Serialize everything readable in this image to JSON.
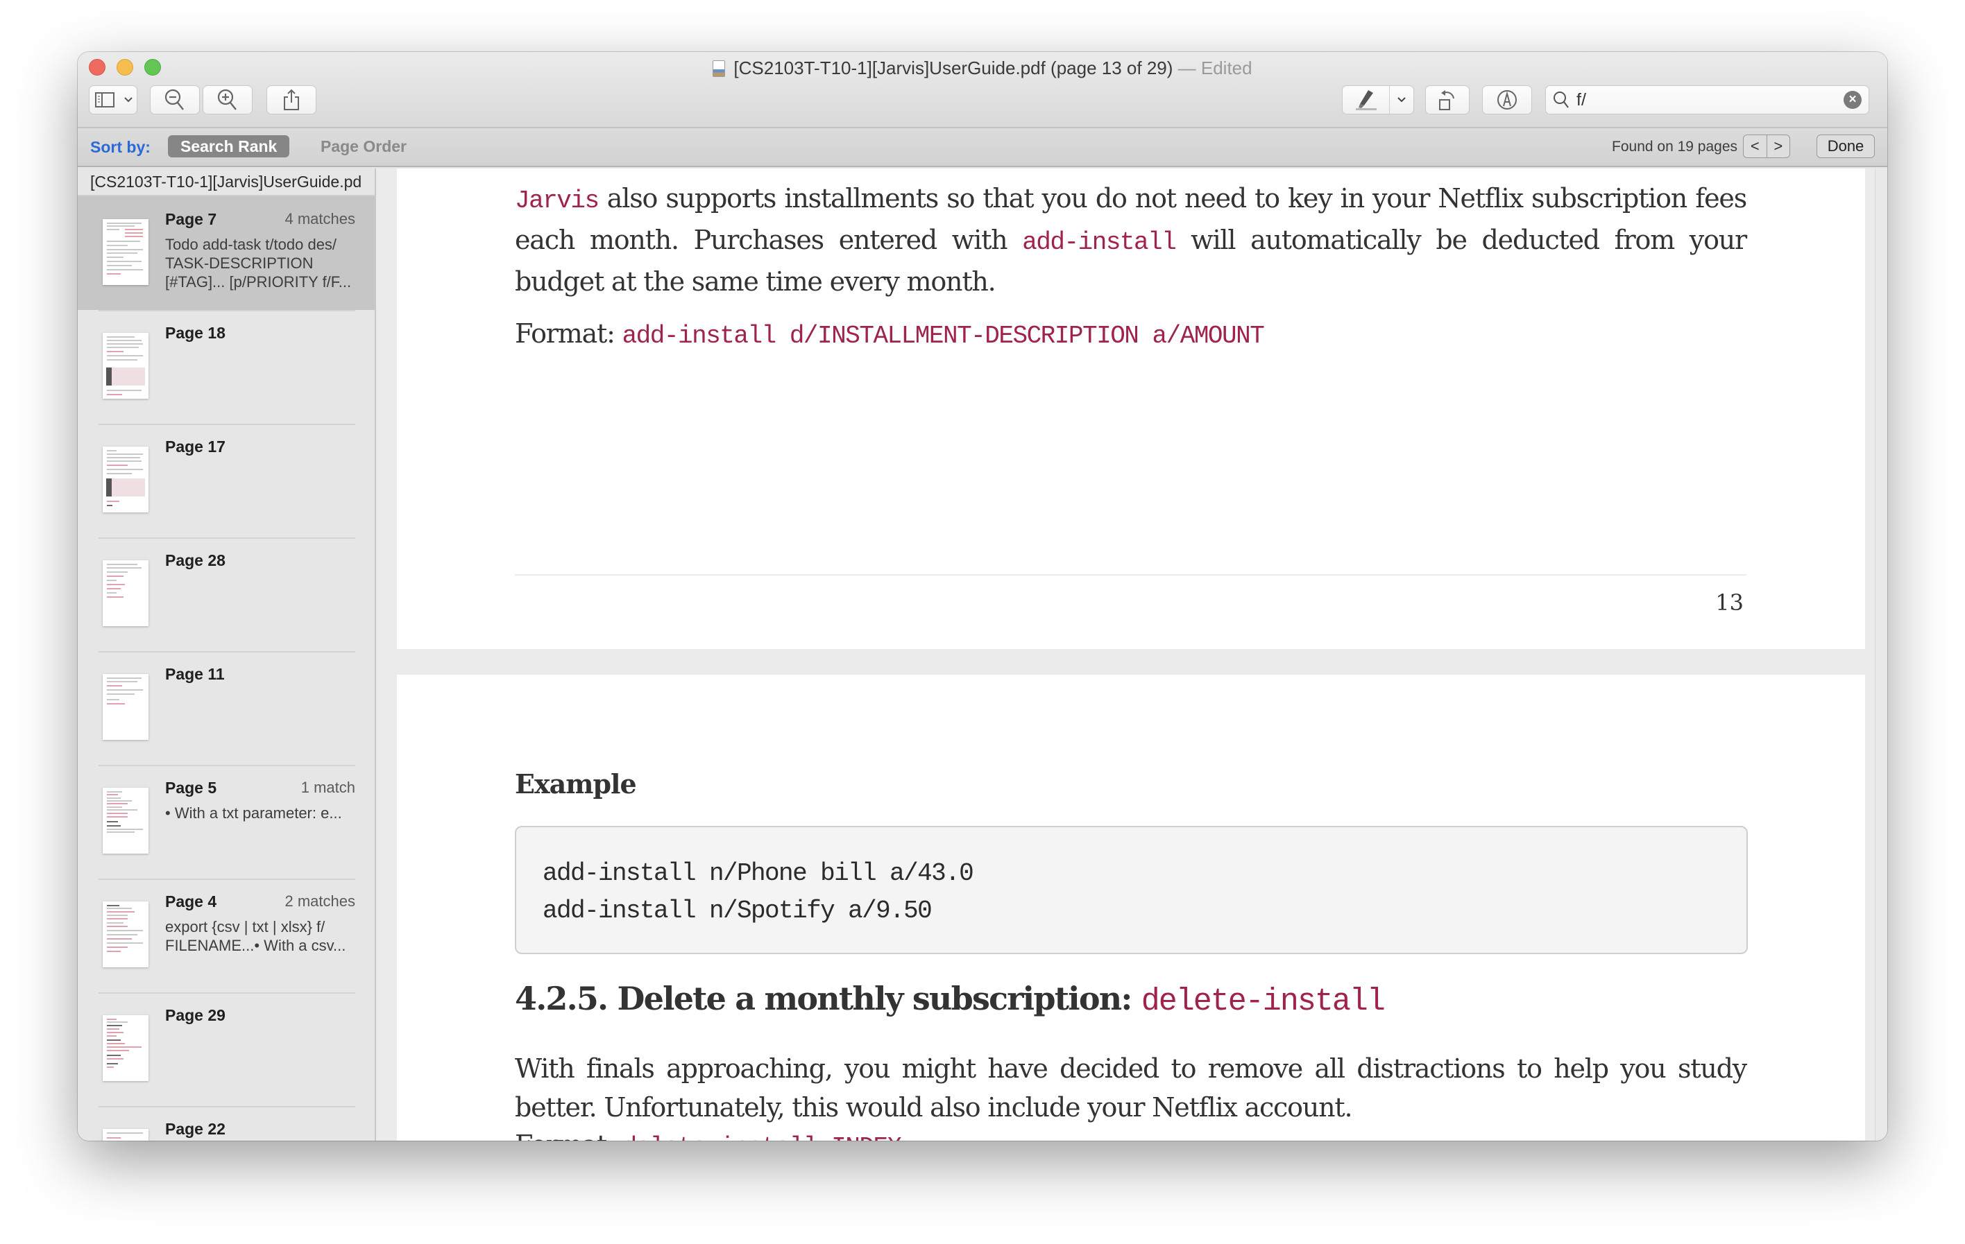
{
  "window": {
    "title": "[CS2103T-T10-1][Jarvis]UserGuide.pdf (page 13 of 29)",
    "title_suffix": "— Edited"
  },
  "toolbar": {
    "sidebar_toggle": "sidebar-icon",
    "zoom_out": "zoom-out-icon",
    "zoom_in": "zoom-in-icon",
    "share": "share-icon",
    "highlight": "highlighter-icon",
    "rotate": "rotate-icon",
    "markup": "markup-icon",
    "search": {
      "value": "f/",
      "placeholder": "Search"
    }
  },
  "findbar": {
    "sort_label": "Sort by:",
    "sort_options": [
      "Search Rank",
      "Page Order"
    ],
    "selected_sort": "Search Rank",
    "found_text": "Found on 19 pages",
    "prev_label": "<",
    "next_label": ">",
    "done_label": "Done"
  },
  "sidebar": {
    "document_name": "[CS2103T-T10-1][Jarvis]UserGuide.pd",
    "results": [
      {
        "page": "Page 7",
        "count": "4 matches",
        "snippet": "Todo add-task t/todo des/ TASK-DESCRIPTION [#TAG]... [p/PRIORITY f/F...",
        "selected": true
      },
      {
        "page": "Page 18",
        "count": "",
        "snippet": ""
      },
      {
        "page": "Page 17",
        "count": "",
        "snippet": ""
      },
      {
        "page": "Page 28",
        "count": "",
        "snippet": ""
      },
      {
        "page": "Page 11",
        "count": "",
        "snippet": ""
      },
      {
        "page": "Page 5",
        "count": "1 match",
        "snippet": "• With a txt parameter: e..."
      },
      {
        "page": "Page 4",
        "count": "2 matches",
        "snippet": "export {csv | txt | xlsx} f/ FILENAME...• With a csv..."
      },
      {
        "page": "Page 29",
        "count": "",
        "snippet": ""
      },
      {
        "page": "Page 22",
        "count": "",
        "snippet": ""
      }
    ]
  },
  "document": {
    "page13": {
      "para1": {
        "code1": "Jarvis",
        "text1": " also supports installments so that you do not need to key in your Netflix subscription fees each month. Purchases entered with ",
        "code2": "add-install",
        "text2": " will automatically be deducted from your budget at the same time every month."
      },
      "format_label": "Format: ",
      "format_code": "add-install d/INSTALLMENT-DESCRIPTION a/AMOUNT",
      "page_number": "13"
    },
    "page14": {
      "example_heading": "Example",
      "code_lines": [
        "add-install n/Phone bill a/43.0",
        "add-install n/Spotify a/9.50"
      ],
      "section_heading": "4.2.5. Delete a monthly subscription: ",
      "section_code": "delete-install",
      "para": "With finals approaching, you might have decided to remove all distractions to help you study better. Unfortunately, this would also include your Netflix account.",
      "format_label": "Format: ",
      "format_code": "delete-install INDEX"
    }
  },
  "colors": {
    "code_accent": "#a0244a",
    "sort_label": "#2a6ad8",
    "selected_result_bg": "#c6c6c6"
  }
}
